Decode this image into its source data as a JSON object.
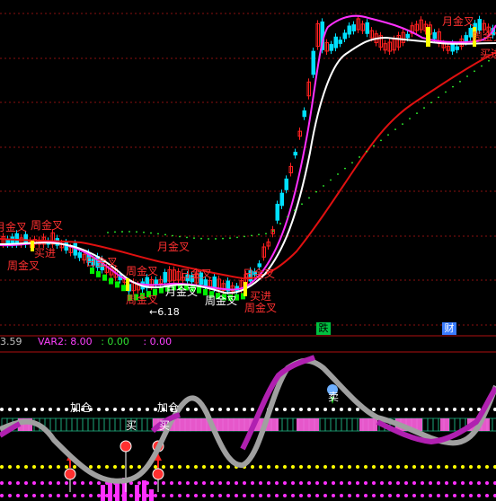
{
  "main_panel": {
    "signal_labels": {
      "month_cross": "月金叉",
      "week_cross": "周金叉",
      "day_cross": "日金叉",
      "buy_in": "买进"
    },
    "price_marker": "←6.18",
    "event_badges": [
      {
        "text": "跌",
        "color": "#00c040"
      },
      {
        "text": "财",
        "color": "#3a7cff"
      }
    ]
  },
  "indicator_status": {
    "first_value": "3.59",
    "var2_label": "VAR2: 8.00",
    "value_b": ": 0.00",
    "value_c": ": 0.00"
  },
  "lower_panel": {
    "add_label": "加仓",
    "buy_label": "买",
    "sell_label": "卖"
  },
  "colors": {
    "up": "#ff2020",
    "down": "#00e0ff",
    "ma_white": "#ffffff",
    "ma_magenta": "#ff30ff",
    "ma_red": "#e01010",
    "signal_yellow": "#ffff00",
    "grid": "#8a1010"
  }
}
